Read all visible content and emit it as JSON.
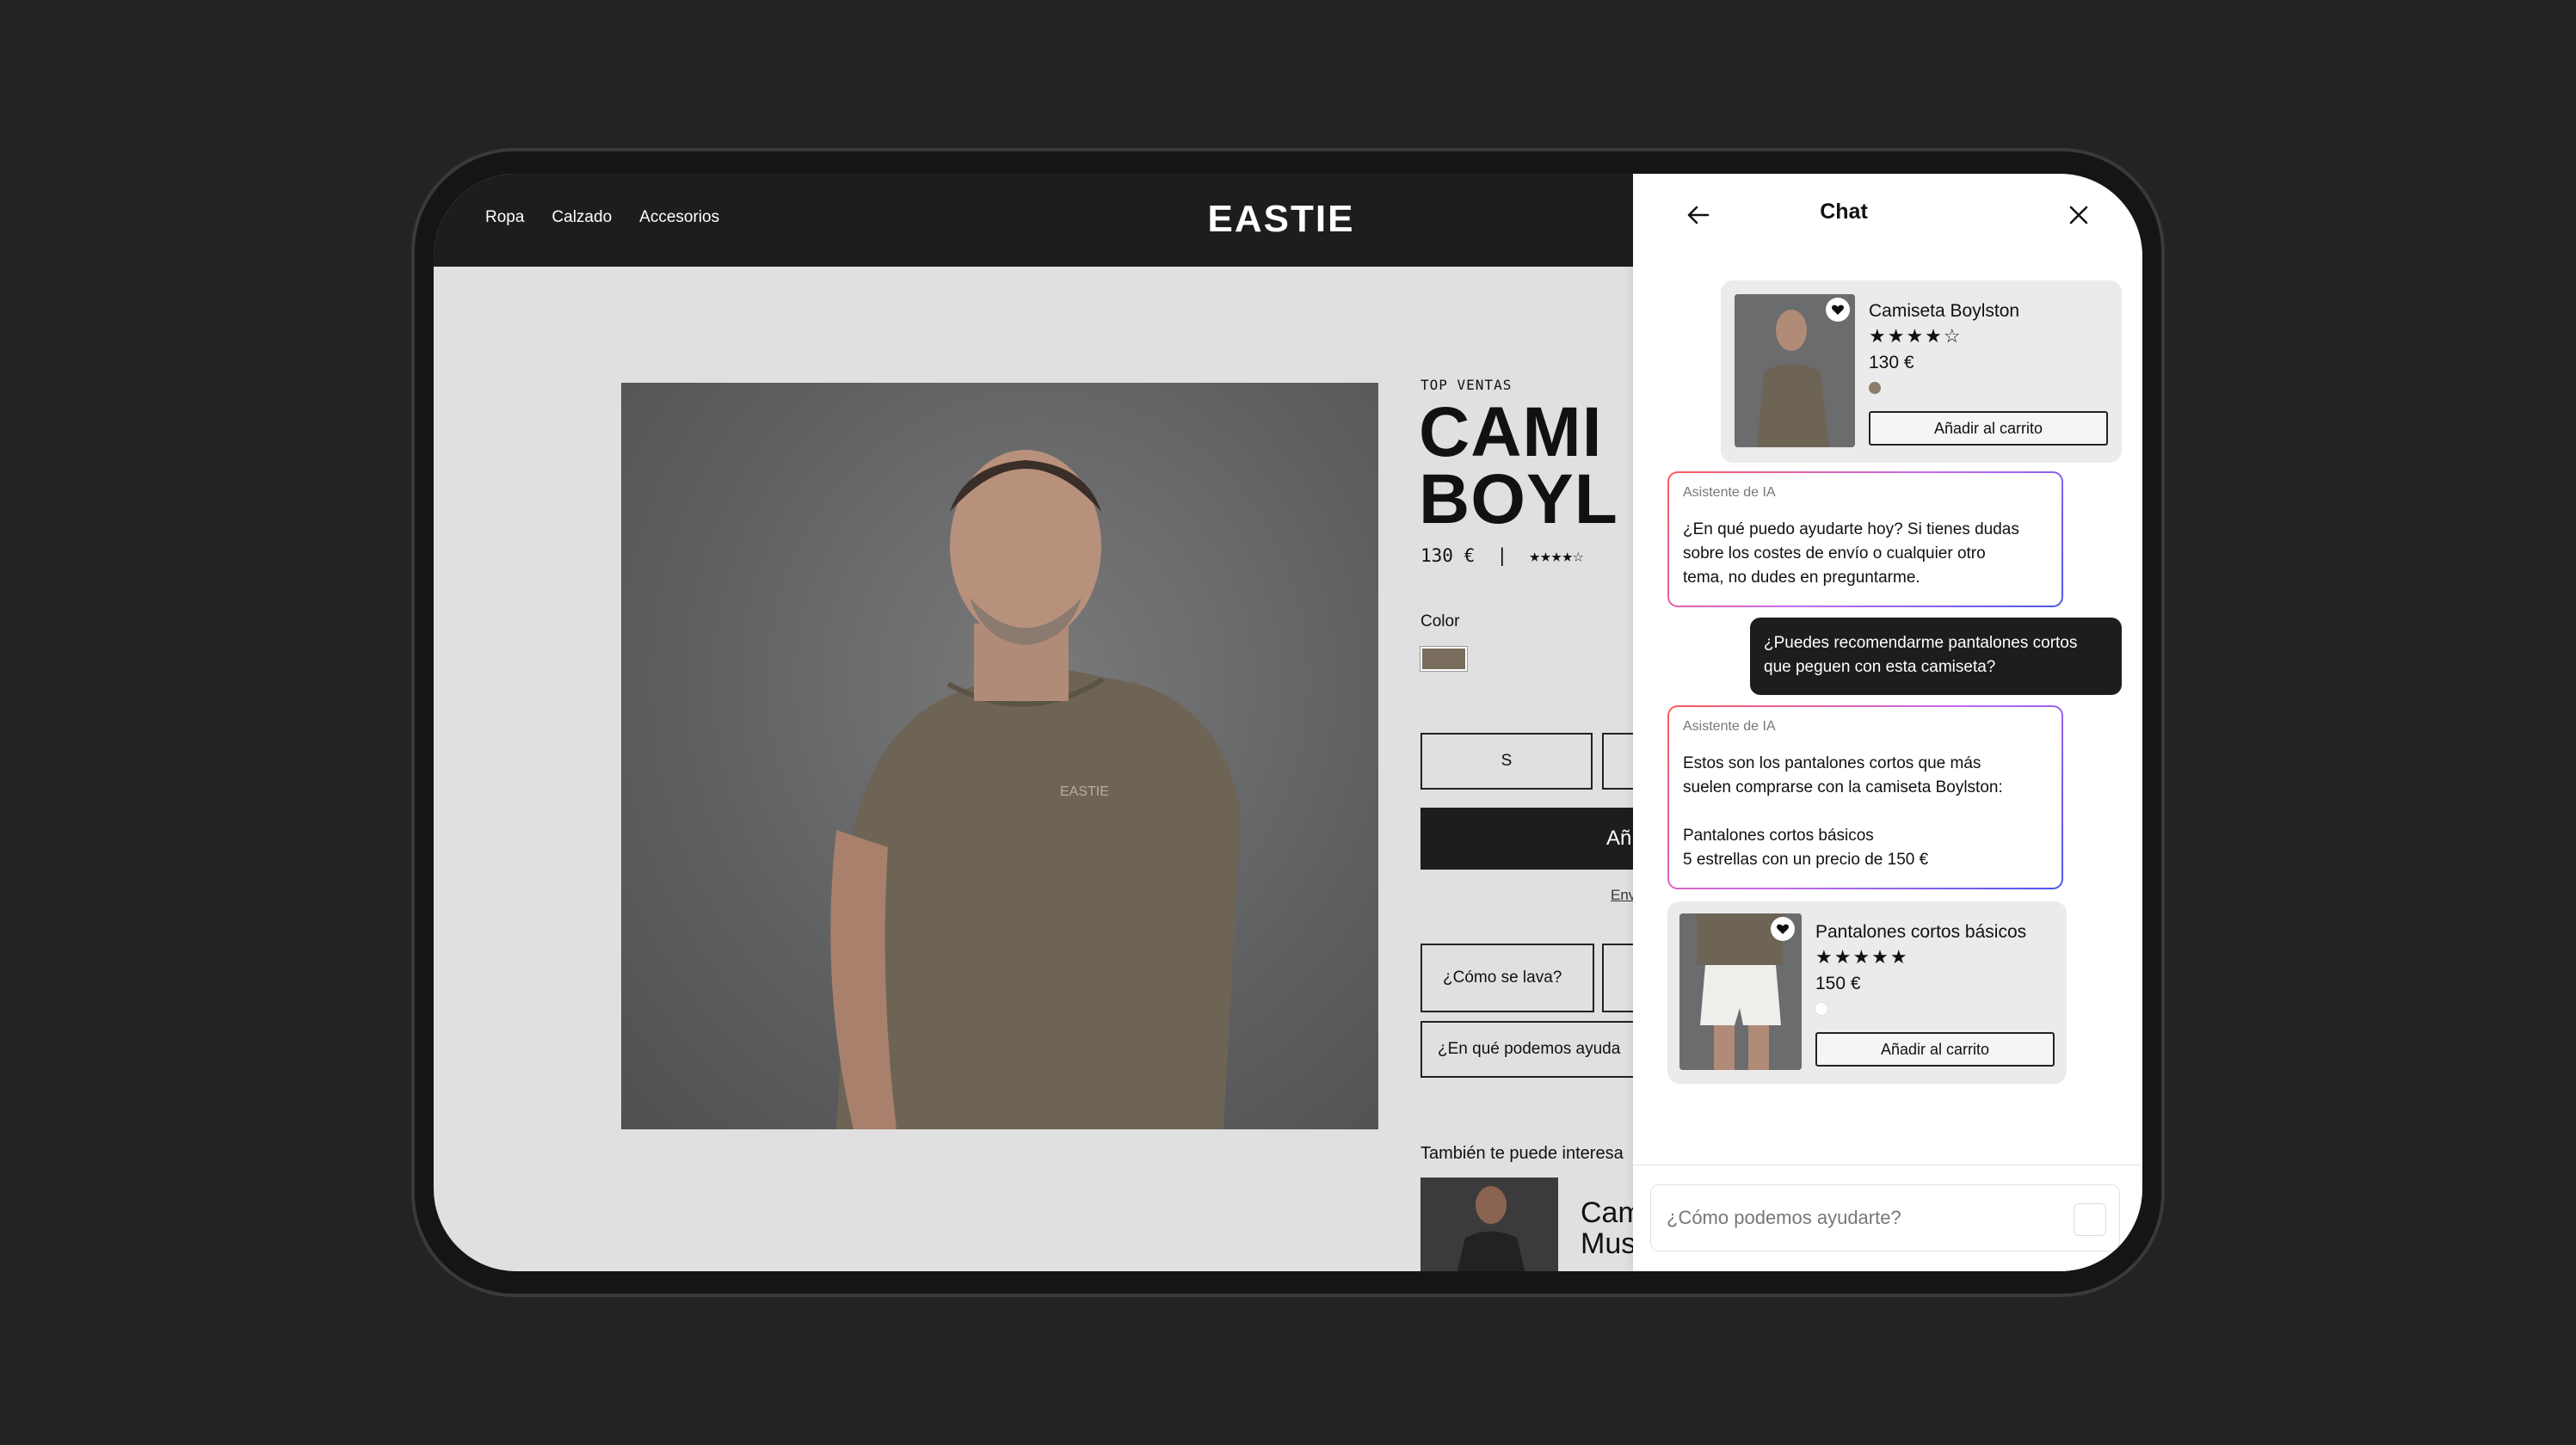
{
  "nav": {
    "links": [
      "Ropa",
      "Calzado",
      "Accesorios"
    ],
    "logo": "EASTIE"
  },
  "product": {
    "eyebrow": "TOP VENTAS",
    "title_visible": "CAMI\nBOYL",
    "price_line": "130 €  |  ★★★★☆",
    "color_label": "Color",
    "color_swatch": "#7a6d5e",
    "sizes": [
      "S",
      ""
    ],
    "add_label": "Añ",
    "shipping_link": "Env",
    "question_buttons": [
      "¿Cómo se lava?",
      ""
    ],
    "ask_placeholder": "¿En qué podemos ayuda",
    "also_label": "También te puede interesa",
    "also_title_visible": "Cam\nMus"
  },
  "chat": {
    "title": "Chat",
    "back_icon": "arrow-left-icon",
    "close_icon": "close-icon",
    "card1": {
      "name": "Camiseta Boylston",
      "stars": "★★★★☆",
      "rating": 4,
      "price": "130 €",
      "dot_color": "#8a7b6a",
      "button": "Añadir al carrito"
    },
    "ai1": {
      "label": "Asistente de IA",
      "text": "¿En qué puedo ayudarte hoy? Si tienes dudas\nsobre los costes de envío o cualquier otro\ntema, no dudes en preguntarme."
    },
    "user1": {
      "text": "¿Puedes recomendarme pantalones cortos\nque peguen con esta camiseta?"
    },
    "ai2": {
      "label": "Asistente de IA",
      "text": "Estos son los pantalones cortos que más\nsuelen comprarse con la camiseta Boylston:\n\nPantalones cortos básicos\n5 estrellas con un precio de 150 €"
    },
    "card2": {
      "name": "Pantalones cortos básicos",
      "stars": "★★★★★",
      "rating": 5,
      "price": "150 €",
      "dot_color": "#ffffff",
      "button": "Añadir al carrito"
    },
    "input_placeholder": "¿Cómo podemos ayudarte?"
  }
}
